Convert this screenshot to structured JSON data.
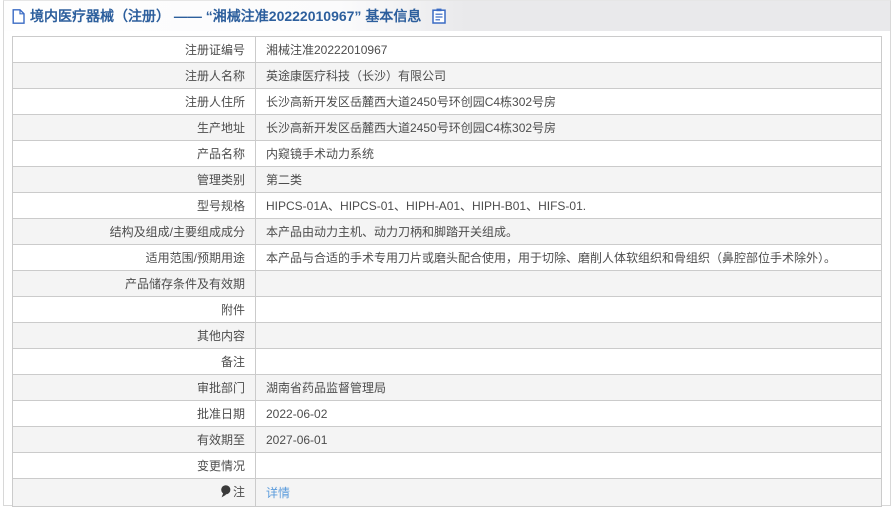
{
  "header": {
    "title": "境内医疗器械（注册） —— “湘械注准20222010967” 基本信息"
  },
  "table": {
    "rows": [
      {
        "label": "注册证编号",
        "value": "湘械注准20222010967"
      },
      {
        "label": "注册人名称",
        "value": "英途康医疗科技（长沙）有限公司"
      },
      {
        "label": "注册人住所",
        "value": "长沙高新开发区岳麓西大道2450号环创园C4栋302号房"
      },
      {
        "label": "生产地址",
        "value": "长沙高新开发区岳麓西大道2450号环创园C4栋302号房"
      },
      {
        "label": "产品名称",
        "value": "内窥镜手术动力系统"
      },
      {
        "label": "管理类别",
        "value": "第二类"
      },
      {
        "label": "型号规格",
        "value": "HIPCS-01A、HIPCS-01、HIPH-A01、HIPH-B01、HIFS-01."
      },
      {
        "label": "结构及组成/主要组成成分",
        "value": "本产品由动力主机、动力刀柄和脚踏开关组成。"
      },
      {
        "label": "适用范围/预期用途",
        "value": "本产品与合适的手术专用刀片或磨头配合使用，用于切除、磨削人体软组织和骨组织（鼻腔部位手术除外）。"
      },
      {
        "label": "产品储存条件及有效期",
        "value": ""
      },
      {
        "label": "附件",
        "value": ""
      },
      {
        "label": "其他内容",
        "value": ""
      },
      {
        "label": "备注",
        "value": ""
      },
      {
        "label": "审批部门",
        "value": "湖南省药品监督管理局"
      },
      {
        "label": "批准日期",
        "value": "2022-06-02"
      },
      {
        "label": "有效期至",
        "value": "2027-06-01"
      },
      {
        "label": "变更情况",
        "value": ""
      },
      {
        "label": "注",
        "value": "详情",
        "link": true,
        "label_icon": "note-bulb-icon"
      }
    ]
  },
  "colors": {
    "title_blue": "#2d5f9d",
    "link_blue": "#5a9bdc",
    "band_gray": "#e9e9eb",
    "border_gray": "#cbcbcb",
    "row_alt": "#f4f4f4"
  }
}
